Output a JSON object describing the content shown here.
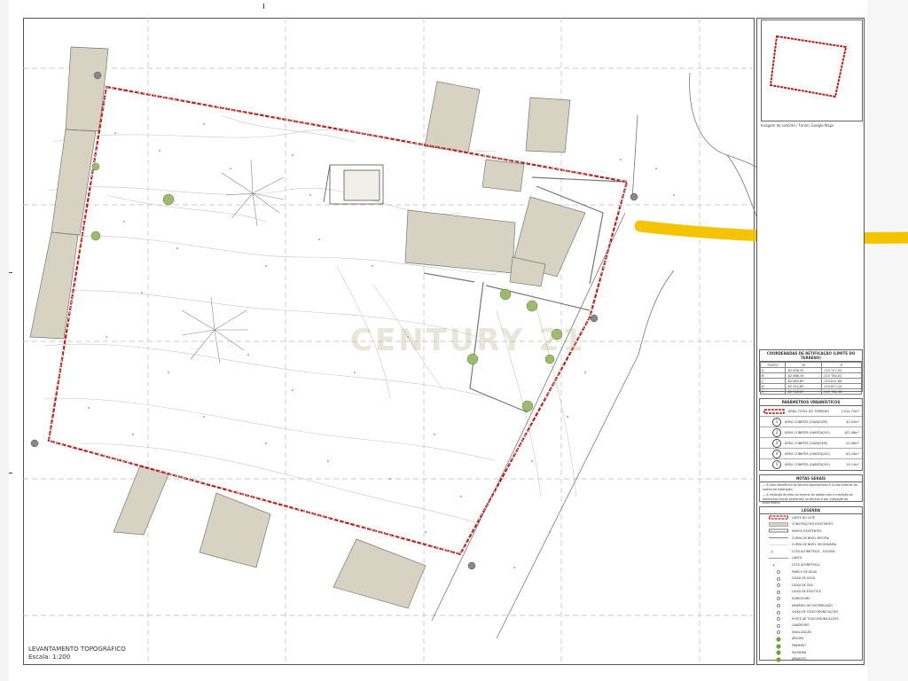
{
  "title": "LEVANTAMENTO TOPOGRÁFICO",
  "scale": "Escala: 1:200",
  "watermark": "CENTURY 21",
  "locator_caption": "Imagem de satélite | Fonte: Google Maps",
  "coords": {
    "title": "COORDENADAS DE RETIFICAÇÃO (LIMITE DO TERRENO)",
    "headers": [
      "PONTO",
      "M",
      "P"
    ],
    "rows": [
      [
        "A",
        "-82 838,32",
        "-115 717,02"
      ],
      [
        "B",
        "-82 868,35",
        "-115 784,02"
      ],
      [
        "C",
        "-82 883,89",
        "-115 811,68"
      ],
      [
        "D",
        "-82 914,89",
        "-115 827,24"
      ],
      [
        "E",
        "-82 908,67",
        "-115 782,08"
      ]
    ]
  },
  "params": {
    "title": "PARÂMETROS URBANÍSTICOS",
    "total_label": "ÁREA TOTAL DO TERRENO",
    "total_value": "2.024,73m²",
    "rows": [
      {
        "n": "1",
        "label": "ÁREA COBERTA (GARAGEM)",
        "value": "40,03m²"
      },
      {
        "n": "2",
        "label": "ÁREA COBERTA (HABITAÇÃO)",
        "value": "102,48m²"
      },
      {
        "n": "3",
        "label": "ÁREA COBERTA (GARAGEM)",
        "value": "22,06m²"
      },
      {
        "n": "4",
        "label": "ÁREA COBERTA (HABITAÇÃO)",
        "value": "63,44m²"
      },
      {
        "n": "5",
        "label": "ÁREA COBERTA (HABITAÇÃO)",
        "value": "14,14m²"
      }
    ]
  },
  "notes": {
    "title": "NOTAS GERAIS",
    "lines": [
      "— A cota altimétrica do terreno apresentada é a cota exterior da soleira da habitação.",
      "— A medição da área do terreno foi obtida com a medição de elementos físicos existentes no terreno e por indicação do proprietário."
    ]
  },
  "legend": {
    "title": "LEGENDA",
    "items": [
      "LIMITE DO LOTE",
      "CONSTRUÇÕES EXISTENTES",
      "MUROS EXISTENTES",
      "CURVA DE NÍVEL MESTRA",
      "CURVA DE NÍVEL SECUNDÁRIA",
      "COTA ALTIMÉTRICA - SOLEIRA",
      "LANCIL",
      "COTA ALTIMÉTRICA",
      "MARCO DE ÁGUA",
      "CAIXA DE ÁGUA",
      "CAIXA DE GÁS",
      "CAIXA DE ESGOTOS",
      "SUMIDOURO",
      "ARMÁRIO DE DISTRIBUIÇÃO",
      "CAIXA DE TELECOMUNICAÇÕES",
      "POSTE DE TELECOMUNICAÇÕES",
      "CANDEEIRO",
      "SINALIZAÇÃO",
      "ÁRVORE",
      "PINHEIRO",
      "PALMEIRA",
      "ARBUSTO"
    ]
  },
  "colors": {
    "boundary": "#b0201c",
    "building": "#d8d2c2",
    "marker": "#f5c400",
    "vegetation": "#6fa33c"
  }
}
